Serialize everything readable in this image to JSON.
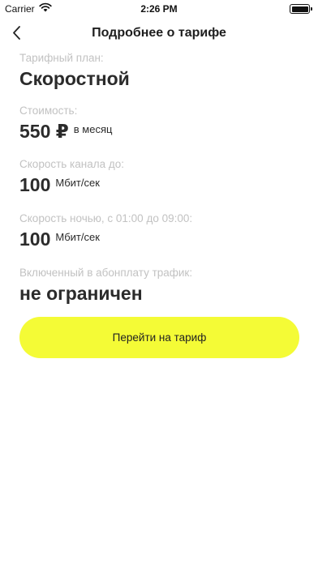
{
  "status_bar": {
    "carrier": "Carrier",
    "time": "2:26 PM"
  },
  "nav": {
    "title": "Подробнее о тарифе",
    "back_icon": "chevron-left-icon"
  },
  "tariff": {
    "plan_label": "Тарифный план:",
    "plan_value": "Скоростной",
    "cost_label": "Стоимость:",
    "cost_value": "550 ₽",
    "cost_unit": "в месяц",
    "speed_label": "Скорость канала до:",
    "speed_value": "100",
    "speed_unit": "Мбит/сек",
    "night_speed_label": "Скорость ночью, с 01:00 до 09:00:",
    "night_speed_value": "100",
    "night_speed_unit": "Мбит/сек",
    "traffic_label": "Включенный в абонплату трафик:",
    "traffic_value": "не ограничен"
  },
  "cta": {
    "label": "Перейти на тариф",
    "color": "#f4fb36"
  }
}
